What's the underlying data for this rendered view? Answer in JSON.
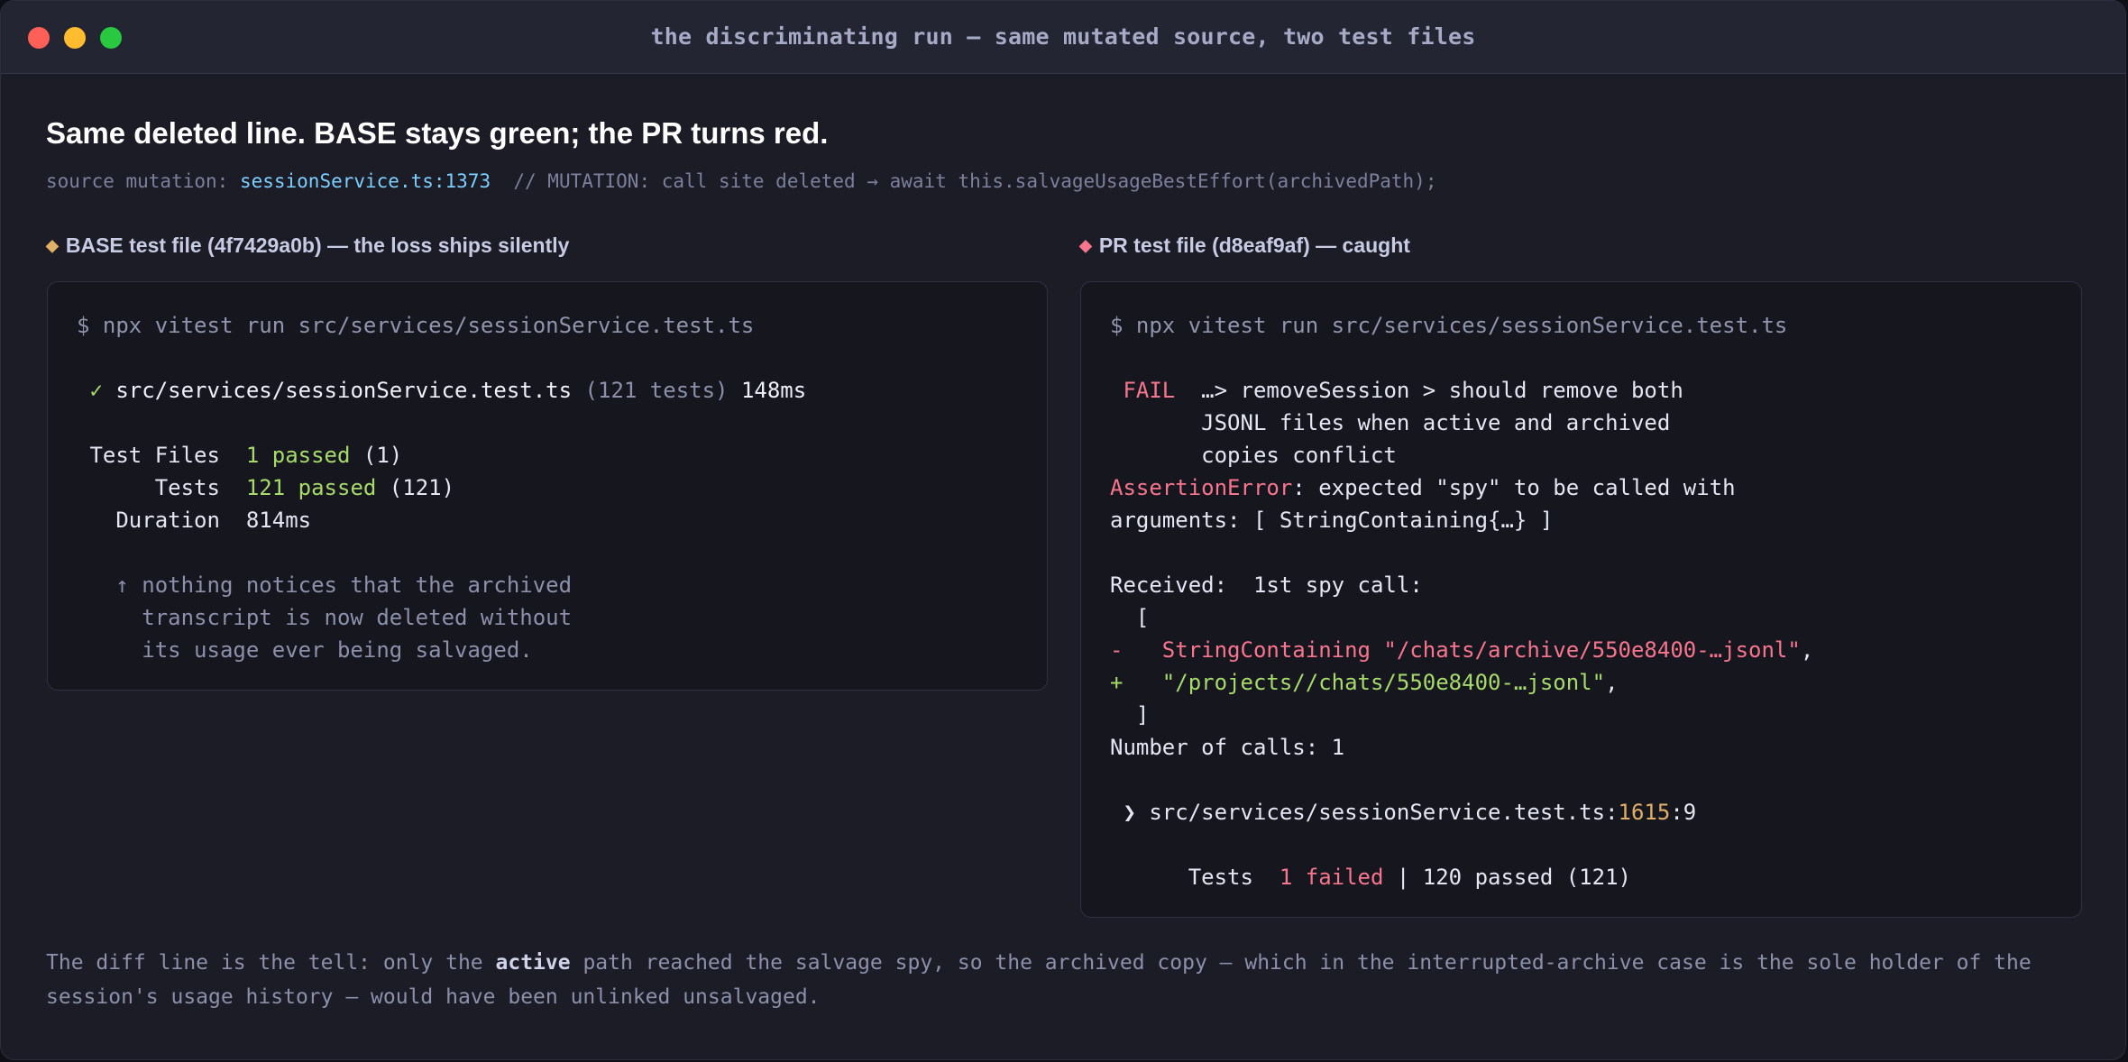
{
  "window": {
    "title": "the discriminating run — same mutated source, two test files"
  },
  "headline": "Same deleted line. BASE stays green; the PR turns red.",
  "mutation": {
    "prefix": "source mutation: ",
    "location": "sessionService.ts:1373",
    "comment": "  // MUTATION: call site deleted → await this.salvageUsageBestEffort(archivedPath);"
  },
  "base_panel": {
    "label": "BASE test file (4f7429a0b) — the loss ships silently",
    "command": "$ npx vitest run src/services/sessionService.test.ts",
    "check": " ✓ ",
    "file": "src/services/sessionService.test.ts",
    "file_count": " (121 tests) ",
    "file_time": "148ms",
    "test_files_key": " Test Files  ",
    "test_files_passed": "1 passed",
    "test_files_total": " (1)",
    "tests_key": "      Tests  ",
    "tests_passed": "121 passed",
    "tests_total": " (121)",
    "duration_key": "   Duration  ",
    "duration_value": "814ms",
    "note_line1": "   ↑ nothing notices that the archived",
    "note_line2": "     transcript is now deleted without",
    "note_line3": "     its usage ever being salvaged."
  },
  "pr_panel": {
    "label": "PR test file (d8eaf9af) — caught",
    "command": "$ npx vitest run src/services/sessionService.test.ts",
    "fail_tag": " FAIL  ",
    "fail_line1": "…> removeSession > should remove both",
    "fail_line2": "       JSONL files when active and archived",
    "fail_line3": "       copies conflict",
    "assertion_error": "AssertionError",
    "assertion_rest": ": expected \"spy\" to be called with",
    "assertion_line2": "arguments: [ StringContaining{…} ]",
    "received": "Received:  1st spy call:",
    "bracket_open": "  [",
    "minus_line": "-   StringContaining \"/chats/archive/550e8400-…jsonl\"",
    "plus_line": "+   \"/projects//chats/550e8400-…jsonl\"",
    "comma": ",",
    "bracket_close": "  ]",
    "calls": "Number of calls: 1",
    "trace_prefix": " ❯ src/services/sessionService.test.ts:",
    "trace_line": "1615",
    "trace_col": ":9",
    "tests_key": "      Tests  ",
    "tests_failed": "1 failed",
    "tests_rest": " | 120 passed (121)"
  },
  "footer": {
    "part1": "The diff line is the tell: only the ",
    "bold": "active",
    "part2": " path reached the salvage spy, so the archived copy — which in the interrupted-archive case is the sole holder of the session's usage history — would have been unlinked unsalvaged."
  },
  "colors": {
    "pass": "#a6db6b",
    "fail": "#f7768e",
    "highlight": "#7dcfff",
    "line_number": "#e0af68"
  }
}
